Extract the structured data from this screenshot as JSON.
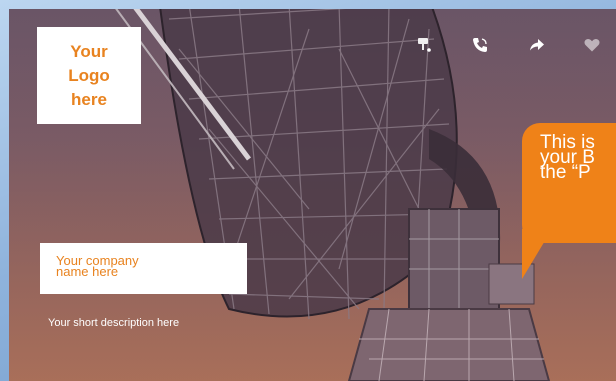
{
  "logo": {
    "text": "Your\nLogo\nhere"
  },
  "company": {
    "name": "Your company\nname here"
  },
  "description": {
    "text": "Your short description here"
  },
  "bubble": {
    "text": "This is\nyour B\nthe “P"
  },
  "toolbar": {
    "icons": [
      "brush-icon",
      "phone-icon",
      "share-icon",
      "heart-icon"
    ]
  },
  "colors": {
    "accent": "#ef8218",
    "logo_text": "#e88320",
    "white": "#ffffff"
  }
}
